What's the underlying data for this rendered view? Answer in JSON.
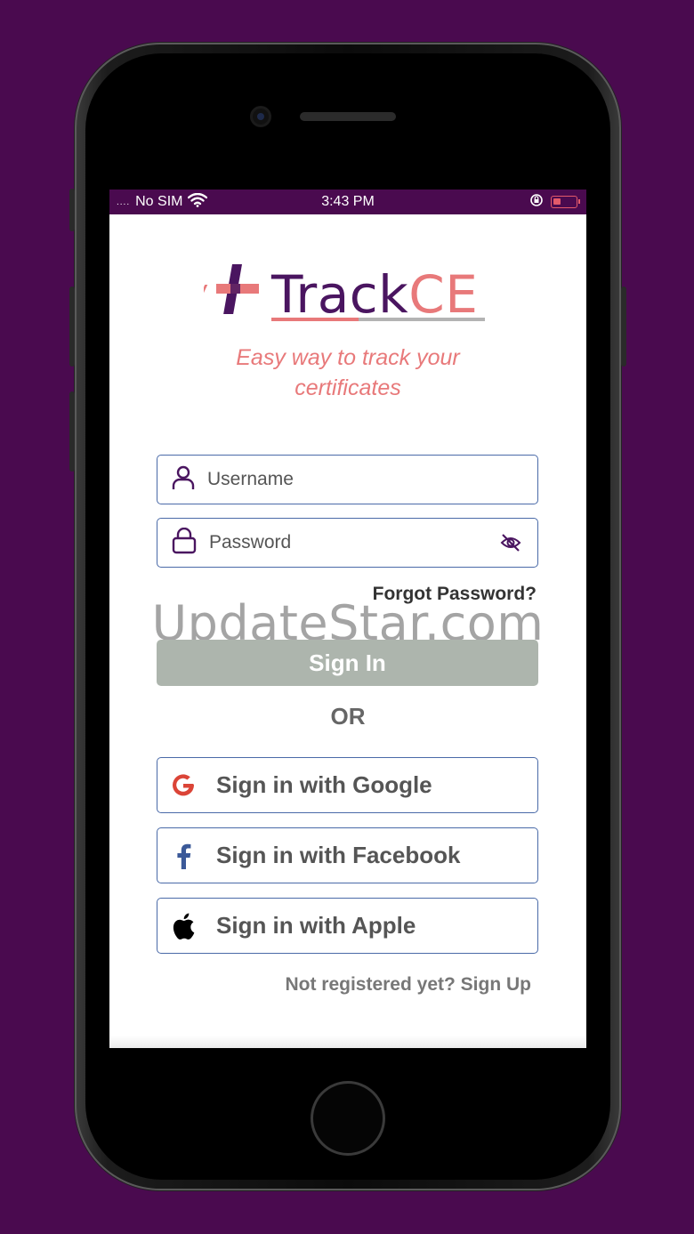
{
  "status_bar": {
    "signal_dots": "....",
    "carrier": "No SIM",
    "time": "3:43 PM",
    "icons": [
      "wifi-icon",
      "orientation-lock-icon",
      "battery-charging-icon"
    ]
  },
  "logo": {
    "brand_part1": "Track",
    "brand_part2": "CE",
    "mark_icon": "cross-icon"
  },
  "tagline": "Easy way to track your certificates",
  "login": {
    "username_placeholder": "Username",
    "password_placeholder": "Password",
    "forgot_label": "Forgot Password?",
    "signin_label": "Sign In",
    "or_label": "OR"
  },
  "social": {
    "google_label": "Sign in with Google",
    "facebook_label": "Sign in with Facebook",
    "apple_label": "Sign in with Apple"
  },
  "signup_label": "Not registered yet? Sign Up",
  "watermark": "UpdateStar.com",
  "colors": {
    "background": "#4a0a4f",
    "brand_purple": "#4a1560",
    "brand_coral": "#e8797a",
    "field_border": "#4a6aa8",
    "button_disabled": "#adb5ad"
  }
}
